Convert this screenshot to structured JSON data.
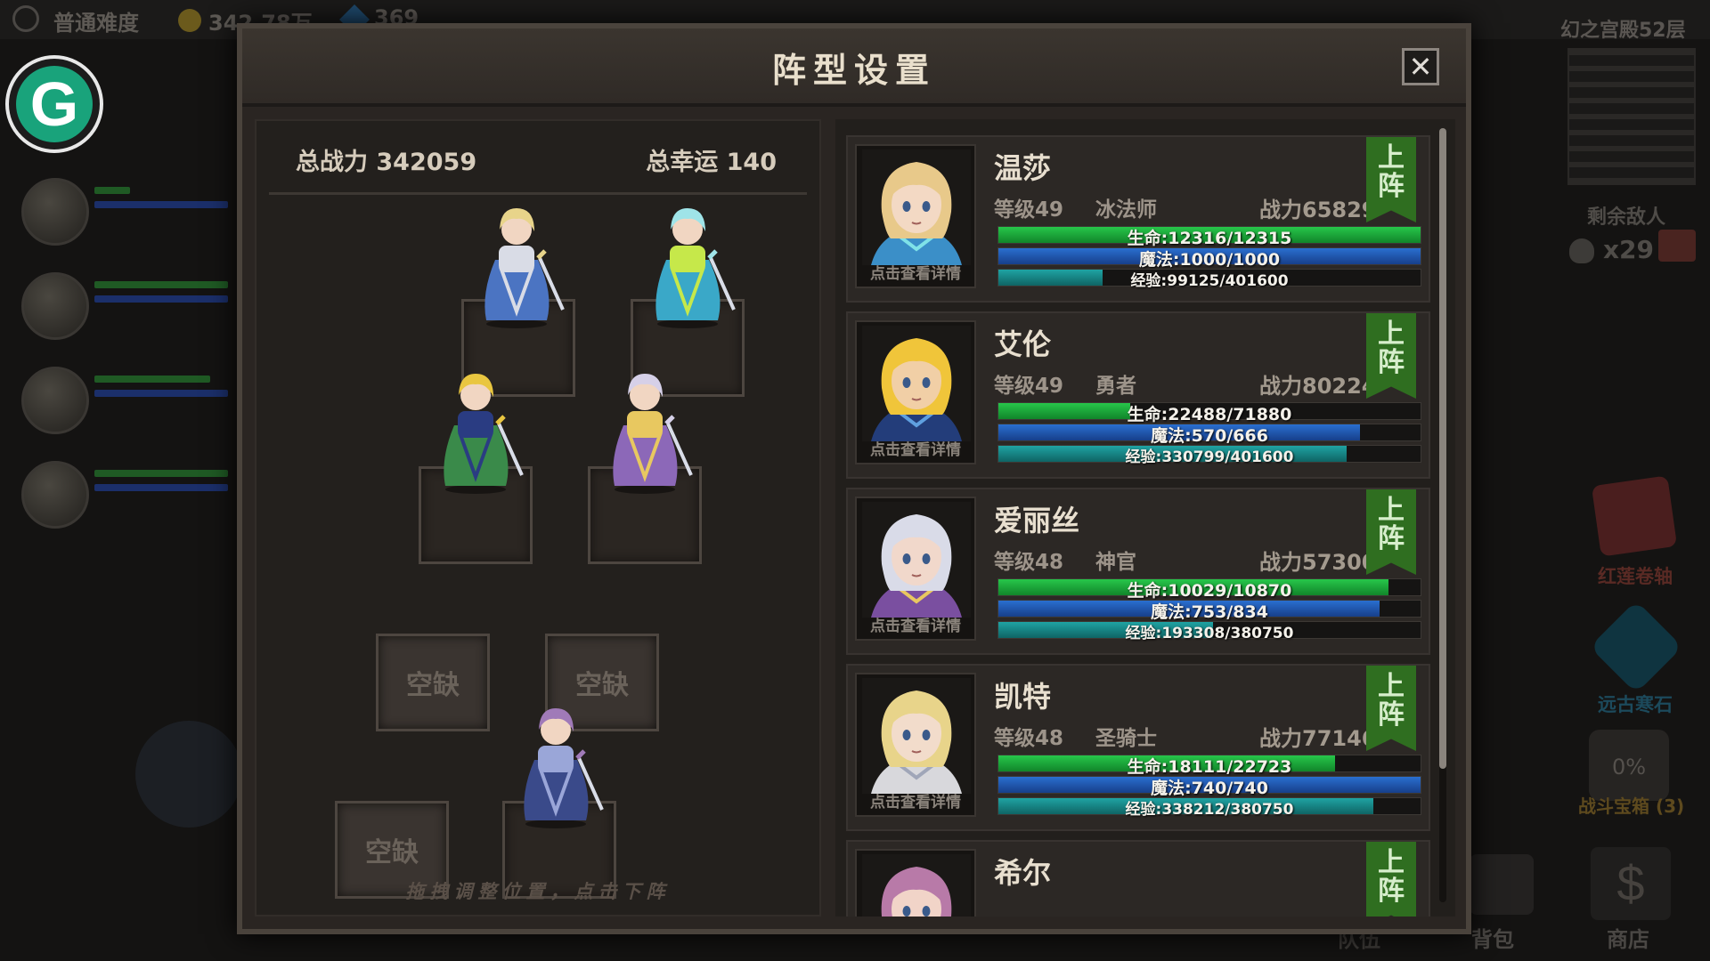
{
  "top_bar": {
    "difficulty": "普通难度",
    "gold": "342.78万",
    "gems": "369"
  },
  "right_hud": {
    "floor": "幻之宫殿52层",
    "enemies_label": "剩余敌人",
    "enemies_count": "x29",
    "item1_label": "红莲卷轴",
    "item2_label": "远古寒石",
    "chest_percent": "0%",
    "chest_label": "战斗宝箱 (3)",
    "team_label": "队伍",
    "bag_label": "背包",
    "shop_label": "商店"
  },
  "dialog": {
    "title": "阵型设置",
    "close_symbol": "✕",
    "total_power": "总战力 342059",
    "total_luck": "总幸运 140",
    "hint": "拖拽调整位置，点击下阵",
    "empty_slot_label": "空缺",
    "detail_label": "点击查看详情",
    "deploy_label_1": "上",
    "deploy_label_2": "阵"
  },
  "heroes": [
    {
      "name": "温莎",
      "level": "等级49",
      "class": "冰法师",
      "power": "战力65829",
      "hp": "生命:12316/12315",
      "hp_ratio": 1.0,
      "mp": "魔法:1000/1000",
      "mp_ratio": 1.0,
      "xp": "经验:99125/401600",
      "xp_ratio": 0.247,
      "palette": {
        "hair": "#e8c98a",
        "skin": "#f3d9c4",
        "cloth": "#3b8fc8",
        "accent": "#7fe2e8"
      }
    },
    {
      "name": "艾伦",
      "level": "等级49",
      "class": "勇者",
      "power": "战力80224",
      "hp": "生命:22488/71880",
      "hp_ratio": 0.313,
      "mp": "魔法:570/666",
      "mp_ratio": 0.856,
      "xp": "经验:330799/401600",
      "xp_ratio": 0.824,
      "palette": {
        "hair": "#f0c53a",
        "skin": "#f1cfa6",
        "cloth": "#233d7a",
        "accent": "#5fa0e0"
      }
    },
    {
      "name": "爱丽丝",
      "level": "等级48",
      "class": "神官",
      "power": "战力57300",
      "hp": "生命:10029/10870",
      "hp_ratio": 0.923,
      "mp": "魔法:753/834",
      "mp_ratio": 0.903,
      "xp": "经验:193308/380750",
      "xp_ratio": 0.508,
      "palette": {
        "hair": "#d9dbe8",
        "skin": "#f1d8cb",
        "cloth": "#7a4fa0",
        "accent": "#e8c860"
      }
    },
    {
      "name": "凯特",
      "level": "等级48",
      "class": "圣骑士",
      "power": "战力77146",
      "hp": "生命:18111/22723",
      "hp_ratio": 0.797,
      "mp": "魔法:740/740",
      "mp_ratio": 1.0,
      "xp": "经验:338212/380750",
      "xp_ratio": 0.888,
      "palette": {
        "hair": "#e8d48a",
        "skin": "#f2dccb",
        "cloth": "#d8d8dc",
        "accent": "#a0a6b8"
      }
    },
    {
      "name": "希尔",
      "level": "",
      "class": "",
      "power": "",
      "hp": "",
      "hp_ratio": 0,
      "mp": "",
      "mp_ratio": 0,
      "xp": "",
      "xp_ratio": 0,
      "palette": {
        "hair": "#b87aa8",
        "skin": "#f1d4c8",
        "cloth": "#5a4070",
        "accent": "#c896c8"
      }
    }
  ],
  "formation": {
    "figures": [
      {
        "name": "knight-figure",
        "cloth": "#4b74c2",
        "hair": "#e8d48a",
        "accent": "#d9dce6"
      },
      {
        "name": "ice-mage-figure",
        "cloth": "#3aa8c8",
        "hair": "#9fe4e8",
        "accent": "#c6e84a"
      },
      {
        "name": "hero-figure",
        "cloth": "#3a8a4a",
        "hair": "#e9c640",
        "accent": "#2a3c82"
      },
      {
        "name": "priestess-figure",
        "cloth": "#8c68b8",
        "hair": "#d6d0e8",
        "accent": "#e8c860"
      },
      {
        "name": "dark-swordswoman-figure",
        "cloth": "#3a4a8a",
        "hair": "#a07ab8",
        "accent": "#9aa6d8"
      }
    ]
  },
  "colors": {
    "hp": "#27c64a",
    "mp": "#2a6fd0",
    "xp": "#1fa3a3",
    "deploy": "#2f6e20"
  }
}
